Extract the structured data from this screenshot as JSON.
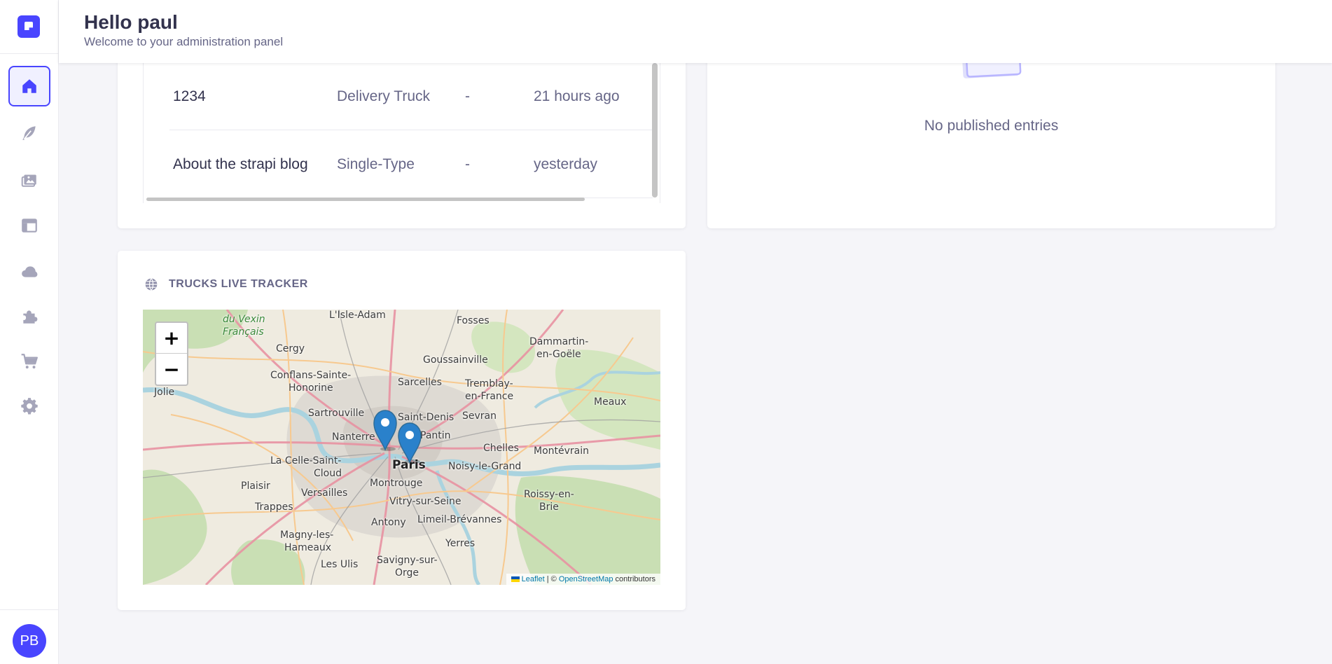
{
  "header": {
    "greeting": "Hello paul",
    "subtitle": "Welcome to your administration panel"
  },
  "sidebar": {
    "items": [
      {
        "icon": "home-icon",
        "active": true
      },
      {
        "icon": "feather-icon"
      },
      {
        "icon": "media-library-icon"
      },
      {
        "icon": "layout-icon"
      },
      {
        "icon": "cloud-icon"
      },
      {
        "icon": "puzzle-icon"
      },
      {
        "icon": "cart-icon"
      },
      {
        "icon": "gear-icon"
      }
    ],
    "avatar_initials": "PB"
  },
  "entries": {
    "rows": [
      {
        "title": "1234",
        "type": "Delivery Truck",
        "status": "-",
        "time": "21 hours ago"
      },
      {
        "title": "About the strapi blog",
        "type": "Single-Type",
        "status": "-",
        "time": "yesterday"
      }
    ]
  },
  "published": {
    "empty_text": "No published entries"
  },
  "tracker": {
    "title": "TRUCKS LIVE TRACKER",
    "zoom_in": "+",
    "zoom_out": "−",
    "attribution": {
      "leaflet": "Leaflet",
      "separator": " | © ",
      "osm": "OpenStreetMap",
      "suffix": " contributors"
    },
    "labels": [
      "du Vexin",
      "Français",
      "L'Isle-Adam",
      "Fosses",
      "Dammartin-",
      "en-Goële",
      "Cergy",
      "Goussainville",
      "Conflans-Sainte-",
      "Honorine",
      "Sarcelles",
      "Tremblay-",
      "en-France",
      "Meaux",
      "Jolie",
      "Sartrouville",
      "Saint-Denis",
      "Sevran",
      "Nanterre",
      "Pantin",
      "Chelles",
      "Montévrain",
      "La Celle-Saint-",
      "Cloud",
      "Paris",
      "Noisy-le-Grand",
      "Plaisir",
      "Versailles",
      "Montrouge",
      "Roissy-en-",
      "Brie",
      "Trappes",
      "Vitry-sur-Seine",
      "Antony",
      "Limeil-Brévannes",
      "Magny-les-",
      "Hameaux",
      "Yerres",
      "Les Ulis",
      "Savigny-sur-",
      "Orge"
    ],
    "colors": {
      "marker": "#2a81cb",
      "accent": "#4945ff"
    }
  }
}
